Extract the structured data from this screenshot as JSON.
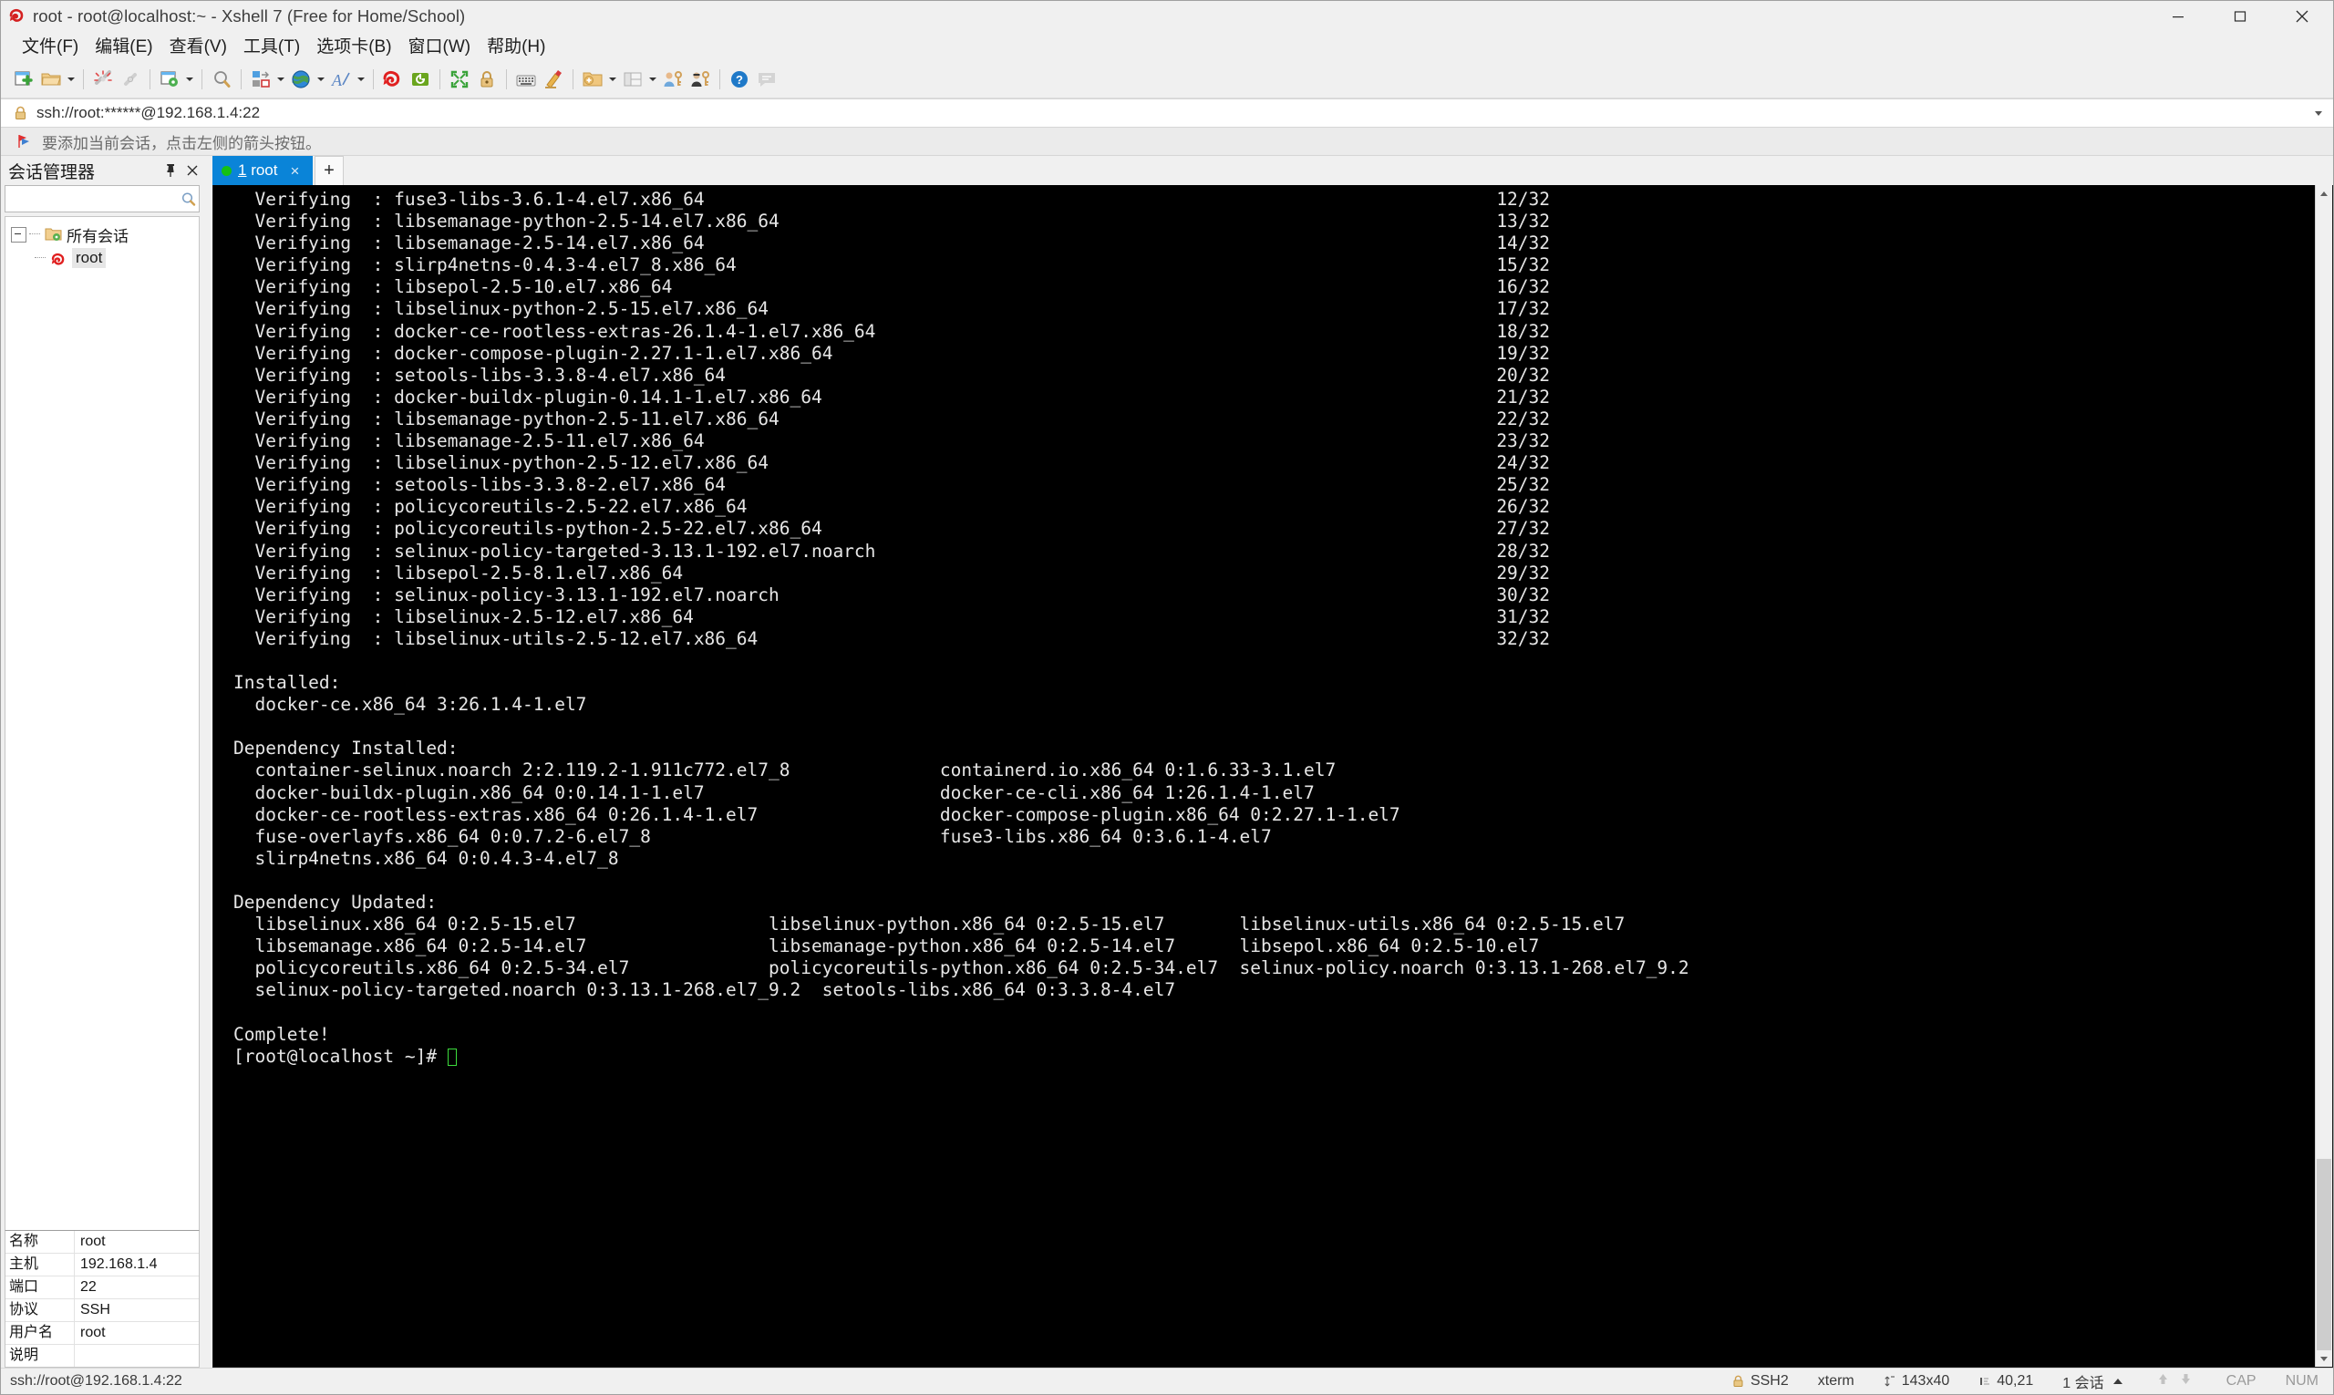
{
  "window": {
    "title": "root - root@localhost:~ - Xshell 7 (Free for Home/School)",
    "app_icon": "xshell-logo-icon",
    "minimize_label": "Minimize",
    "maximize_label": "Maximize",
    "close_label": "Close"
  },
  "menubar": {
    "items": [
      {
        "label": "文件(F)",
        "name": "menu-file"
      },
      {
        "label": "编辑(E)",
        "name": "menu-edit"
      },
      {
        "label": "查看(V)",
        "name": "menu-view"
      },
      {
        "label": "工具(T)",
        "name": "menu-tools"
      },
      {
        "label": "选项卡(B)",
        "name": "menu-tabs"
      },
      {
        "label": "窗口(W)",
        "name": "menu-window"
      },
      {
        "label": "帮助(H)",
        "name": "menu-help"
      }
    ]
  },
  "toolbar": {
    "buttons": [
      {
        "name": "new-session-icon",
        "has_arrow": false
      },
      {
        "name": "open-folder-icon",
        "has_arrow": true
      },
      {
        "sep": true
      },
      {
        "name": "disconnect-icon",
        "has_arrow": false
      },
      {
        "name": "reconnect-icon",
        "has_arrow": false
      },
      {
        "sep": true
      },
      {
        "name": "session-properties-icon",
        "has_arrow": true
      },
      {
        "sep": true
      },
      {
        "name": "find-icon",
        "has_arrow": false
      },
      {
        "sep": true
      },
      {
        "name": "layout-icon",
        "has_arrow": true
      },
      {
        "name": "globe-encoding-icon",
        "has_arrow": true
      },
      {
        "name": "font-icon",
        "has_arrow": true
      },
      {
        "sep": true
      },
      {
        "name": "xshell-icon",
        "has_arrow": false
      },
      {
        "name": "xftp-icon",
        "has_arrow": false
      },
      {
        "sep": true
      },
      {
        "name": "fullscreen-icon",
        "has_arrow": false
      },
      {
        "name": "lock-icon",
        "has_arrow": false
      },
      {
        "sep": true
      },
      {
        "name": "keyboard-icon",
        "has_arrow": false
      },
      {
        "name": "highlight-icon",
        "has_arrow": false
      },
      {
        "sep": true
      },
      {
        "name": "new-folder-icon",
        "has_arrow": true
      },
      {
        "name": "panes-icon",
        "has_arrow": true
      },
      {
        "name": "user-key-icon",
        "has_arrow": false
      },
      {
        "name": "admin-key-icon",
        "has_arrow": false
      },
      {
        "sep": true
      },
      {
        "name": "help-icon",
        "has_arrow": false
      },
      {
        "name": "feedback-icon",
        "has_arrow": false
      }
    ]
  },
  "address_bar": {
    "icon": "lock-icon",
    "url": "ssh://root:******@192.168.1.4:22",
    "dropdown_icon": "chevron-down-icon"
  },
  "notice_bar": {
    "icon": "red-flag-icon",
    "message": "要添加当前会话，点击左侧的箭头按钮。"
  },
  "session_manager": {
    "title": "会话管理器",
    "pin_icon": "pin-icon",
    "close_icon": "close-icon",
    "search": {
      "value": "",
      "placeholder": "",
      "icon": "search-icon"
    },
    "tree": [
      {
        "label": "所有会话",
        "icon": "folder-sessions-icon",
        "level": 0,
        "expanded": true,
        "selected": false
      },
      {
        "label": "root",
        "icon": "xshell-session-icon",
        "level": 1,
        "expanded": false,
        "selected": true
      }
    ],
    "properties": [
      {
        "key": "名称",
        "value": "root"
      },
      {
        "key": "主机",
        "value": "192.168.1.4"
      },
      {
        "key": "端口",
        "value": "22"
      },
      {
        "key": "协议",
        "value": "SSH"
      },
      {
        "key": "用户名",
        "value": "root"
      },
      {
        "key": "说明",
        "value": ""
      }
    ]
  },
  "tabs": {
    "items": [
      {
        "index": "1",
        "label": " root",
        "active": true,
        "status_color": "#15c115",
        "close_label": "×"
      }
    ],
    "new_tab_label": "+"
  },
  "terminal": {
    "lines": [
      "  Verifying  : fuse3-libs-3.6.1-4.el7.x86_64                                                                          12/32",
      "  Verifying  : libsemanage-python-2.5-14.el7.x86_64                                                                   13/32",
      "  Verifying  : libsemanage-2.5-14.el7.x86_64                                                                          14/32",
      "  Verifying  : slirp4netns-0.4.3-4.el7_8.x86_64                                                                       15/32",
      "  Verifying  : libsepol-2.5-10.el7.x86_64                                                                             16/32",
      "  Verifying  : libselinux-python-2.5-15.el7.x86_64                                                                    17/32",
      "  Verifying  : docker-ce-rootless-extras-26.1.4-1.el7.x86_64                                                          18/32",
      "  Verifying  : docker-compose-plugin-2.27.1-1.el7.x86_64                                                              19/32",
      "  Verifying  : setools-libs-3.3.8-4.el7.x86_64                                                                        20/32",
      "  Verifying  : docker-buildx-plugin-0.14.1-1.el7.x86_64                                                               21/32",
      "  Verifying  : libsemanage-python-2.5-11.el7.x86_64                                                                   22/32",
      "  Verifying  : libsemanage-2.5-11.el7.x86_64                                                                          23/32",
      "  Verifying  : libselinux-python-2.5-12.el7.x86_64                                                                    24/32",
      "  Verifying  : setools-libs-3.3.8-2.el7.x86_64                                                                        25/32",
      "  Verifying  : policycoreutils-2.5-22.el7.x86_64                                                                      26/32",
      "  Verifying  : policycoreutils-python-2.5-22.el7.x86_64                                                               27/32",
      "  Verifying  : selinux-policy-targeted-3.13.1-192.el7.noarch                                                          28/32",
      "  Verifying  : libsepol-2.5-8.1.el7.x86_64                                                                            29/32",
      "  Verifying  : selinux-policy-3.13.1-192.el7.noarch                                                                   30/32",
      "  Verifying  : libselinux-2.5-12.el7.x86_64                                                                           31/32",
      "  Verifying  : libselinux-utils-2.5-12.el7.x86_64                                                                     32/32",
      "",
      "Installed:",
      "  docker-ce.x86_64 3:26.1.4-1.el7",
      "",
      "Dependency Installed:",
      "  container-selinux.noarch 2:2.119.2-1.911c772.el7_8              containerd.io.x86_64 0:1.6.33-3.1.el7",
      "  docker-buildx-plugin.x86_64 0:0.14.1-1.el7                      docker-ce-cli.x86_64 1:26.1.4-1.el7",
      "  docker-ce-rootless-extras.x86_64 0:26.1.4-1.el7                 docker-compose-plugin.x86_64 0:2.27.1-1.el7",
      "  fuse-overlayfs.x86_64 0:0.7.2-6.el7_8                           fuse3-libs.x86_64 0:3.6.1-4.el7",
      "  slirp4netns.x86_64 0:0.4.3-4.el7_8",
      "",
      "Dependency Updated:",
      "  libselinux.x86_64 0:2.5-15.el7                  libselinux-python.x86_64 0:2.5-15.el7       libselinux-utils.x86_64 0:2.5-15.el7",
      "  libsemanage.x86_64 0:2.5-14.el7                 libsemanage-python.x86_64 0:2.5-14.el7      libsepol.x86_64 0:2.5-10.el7",
      "  policycoreutils.x86_64 0:2.5-34.el7             policycoreutils-python.x86_64 0:2.5-34.el7  selinux-policy.noarch 0:3.13.1-268.el7_9.2",
      "  selinux-policy-targeted.noarch 0:3.13.1-268.el7_9.2  setools-libs.x86_64 0:3.3.8-4.el7",
      "",
      "Complete!"
    ],
    "prompt": "[root@localhost ~]# ",
    "cursor_visible": true,
    "scrollbar": {
      "name": "terminal-scrollbar"
    }
  },
  "statusbar": {
    "connection": "ssh://root@192.168.1.4:22",
    "cells": [
      {
        "name": "status-security",
        "icon": "lock-icon",
        "label": "SSH2"
      },
      {
        "name": "status-termtype",
        "icon": "",
        "label": "xterm"
      },
      {
        "name": "status-size",
        "icon": "resize-icon",
        "label": "143x40"
      },
      {
        "name": "status-cursor",
        "icon": "cursor-icon",
        "label": "40,21"
      },
      {
        "name": "status-sessions",
        "icon": "",
        "label": "1 会话"
      }
    ],
    "caps": "CAP",
    "num": "NUM",
    "upload_icon": "arrow-up-icon",
    "download_icon": "arrow-down-icon"
  },
  "colors": {
    "accent": "#0a84d8",
    "terminal_bg": "#000000",
    "terminal_fg": "#e6e6e6",
    "cursor": "#3ddc3d",
    "chrome": "#f0f0f0"
  }
}
